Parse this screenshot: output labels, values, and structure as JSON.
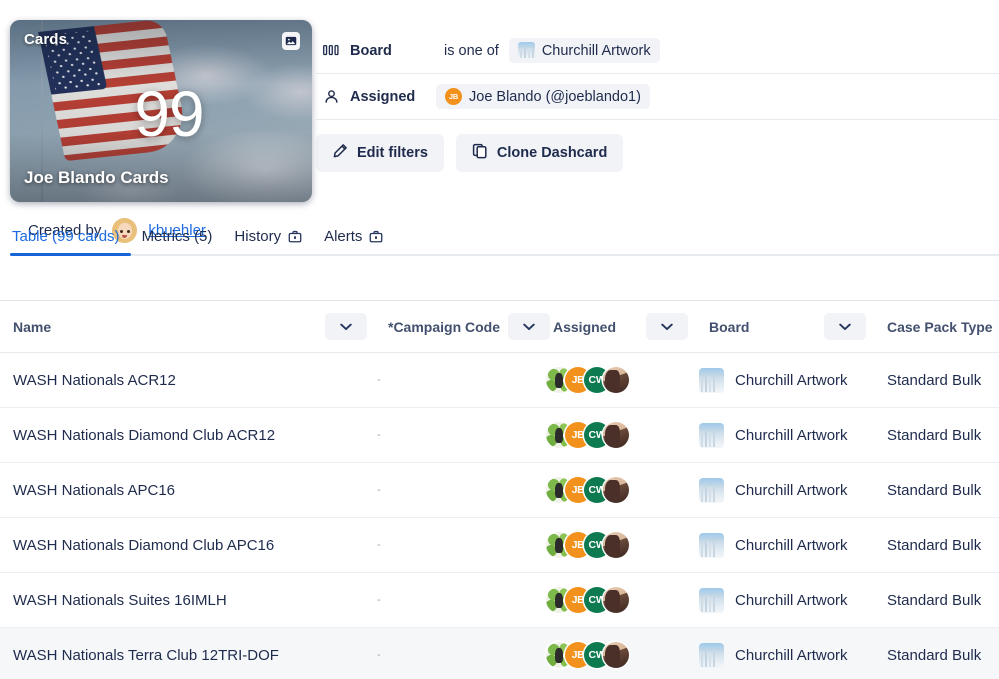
{
  "dashcard": {
    "label": "Cards",
    "value": "99",
    "title": "Joe Blando Cards",
    "image_button_icon": "image-icon"
  },
  "created_by": {
    "label": "Created by",
    "user": "kbuehler",
    "avatar_icon": "avatar"
  },
  "filters": [
    {
      "icon": "board-icon",
      "name": "Board",
      "operator": "is one of",
      "chip": {
        "icon": "board-thumbnail",
        "text": "Churchill Artwork"
      }
    },
    {
      "icon": "person-icon",
      "name": "Assigned",
      "operator": "",
      "chip": {
        "icon": "avatar-jb",
        "avatar_initials": "JB",
        "text": "Joe Blando (@joeblando1)"
      }
    }
  ],
  "buttons": {
    "edit_filters": "Edit filters",
    "edit_filters_icon": "pencil-icon",
    "clone_dashcard": "Clone Dashcard",
    "clone_dashcard_icon": "copy-icon"
  },
  "tabs": [
    {
      "label": "Table (99 cards)",
      "active": true,
      "icon": null
    },
    {
      "label": "Metrics (5)",
      "active": false,
      "icon": null
    },
    {
      "label": "History",
      "active": false,
      "icon": "briefcase-icon"
    },
    {
      "label": "Alerts",
      "active": false,
      "icon": "briefcase-icon"
    }
  ],
  "table": {
    "columns": [
      {
        "label": "Name",
        "has_menu": true
      },
      {
        "label": "*Campaign Code",
        "has_menu": true
      },
      {
        "label": "Assigned",
        "has_menu": true
      },
      {
        "label": "Board",
        "has_menu": true
      },
      {
        "label": "Case Pack Type",
        "has_menu": true
      }
    ],
    "rows": [
      {
        "name": "WASH Nationals ACR12",
        "campaign_code": "-",
        "assigned": [
          "photo",
          "JB",
          "CW",
          "photo"
        ],
        "board": "Churchill Artwork",
        "case_pack_type": "Standard Bulk",
        "highlighted": false
      },
      {
        "name": "WASH Nationals Diamond Club ACR12",
        "campaign_code": "-",
        "assigned": [
          "photo",
          "JB",
          "CW",
          "photo"
        ],
        "board": "Churchill Artwork",
        "case_pack_type": "Standard Bulk",
        "highlighted": false
      },
      {
        "name": "WASH Nationals APC16",
        "campaign_code": "-",
        "assigned": [
          "photo",
          "JB",
          "CW",
          "photo"
        ],
        "board": "Churchill Artwork",
        "case_pack_type": "Standard Bulk",
        "highlighted": false
      },
      {
        "name": "WASH Nationals Diamond Club APC16",
        "campaign_code": "-",
        "assigned": [
          "photo",
          "JB",
          "CW",
          "photo"
        ],
        "board": "Churchill Artwork",
        "case_pack_type": "Standard Bulk",
        "highlighted": false
      },
      {
        "name": "WASH Nationals Suites 16IMLH",
        "campaign_code": "-",
        "assigned": [
          "photo",
          "JB",
          "CW",
          "photo"
        ],
        "board": "Churchill Artwork",
        "case_pack_type": "Standard Bulk",
        "highlighted": false
      },
      {
        "name": "WASH Nationals Terra Club 12TRI-DOF",
        "campaign_code": "-",
        "assigned": [
          "photo",
          "JB",
          "CW",
          "photo"
        ],
        "board": "Churchill Artwork",
        "case_pack_type": "Standard Bulk",
        "highlighted": true
      }
    ]
  },
  "colors": {
    "accent": "#1565d8",
    "link": "#1a6ae0",
    "text": "#1f2b4d",
    "chip_bg": "#f1f3f6",
    "avatar_orange": "#f2911b",
    "avatar_green": "#0d7a4f",
    "row_highlight": "#f6f7f9"
  }
}
